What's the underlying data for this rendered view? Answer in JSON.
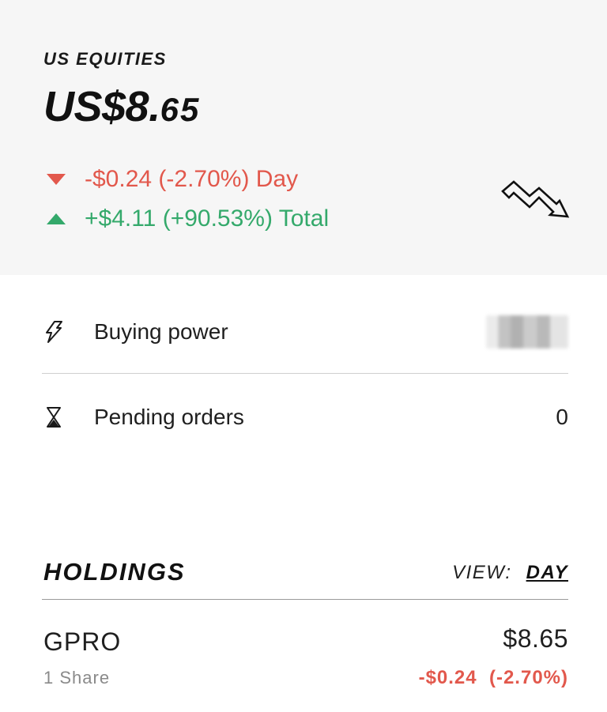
{
  "summary": {
    "section_label": "US EQUITIES",
    "total_main": "US$8.",
    "total_cents": "65",
    "day_change": "-$0.24 (-2.70%) Day",
    "total_change": "+$4.11 (+90.53%) Total",
    "day_direction": "down",
    "total_direction": "up",
    "trend_icon": "trend-down-icon"
  },
  "account": {
    "buying_power_label": "Buying power",
    "buying_power_icon": "lightning-icon",
    "pending_orders_label": "Pending orders",
    "pending_orders_icon": "hourglass-icon",
    "pending_orders_value": "0"
  },
  "holdings": {
    "title": "HOLDINGS",
    "view_label": "VIEW:",
    "view_value": "DAY",
    "items": [
      {
        "ticker": "GPRO",
        "shares": "1 Share",
        "price": "$8.65",
        "day_change": "-$0.24  (-2.70%)"
      }
    ]
  },
  "colors": {
    "negative": "#e2584c",
    "positive": "#34a96b",
    "summary_background": "#f6f6f6"
  }
}
